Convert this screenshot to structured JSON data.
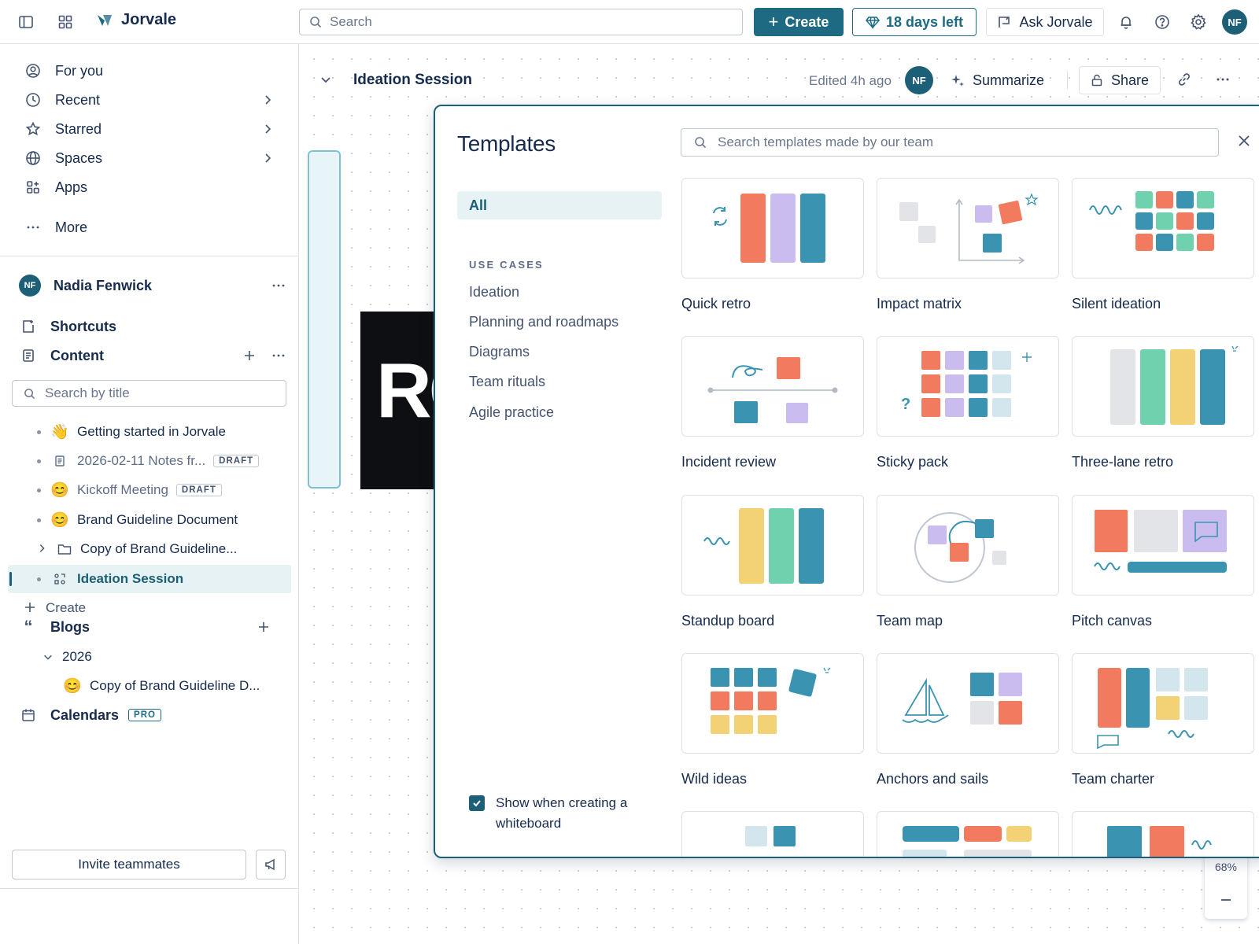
{
  "app": {
    "name": "Jorvale"
  },
  "topbar": {
    "search_placeholder": "Search",
    "create_label": "Create",
    "trial_label": "18 days left",
    "ask_label": "Ask Jorvale",
    "avatar_initials": "NF"
  },
  "sidebar": {
    "nav": [
      {
        "label": "For you",
        "icon": "user-circle-icon"
      },
      {
        "label": "Recent",
        "icon": "clock-icon"
      },
      {
        "label": "Starred",
        "icon": "star-icon"
      },
      {
        "label": "Spaces",
        "icon": "globe-icon"
      },
      {
        "label": "Apps",
        "icon": "apps-icon"
      },
      {
        "label": "More",
        "icon": "more-icon"
      }
    ],
    "space": {
      "name": "Nadia Fenwick",
      "avatar_initials": "NF"
    },
    "shortcuts_label": "Shortcuts",
    "content_label": "Content",
    "search_placeholder": "Search by title",
    "tree": [
      {
        "label": "Getting started in Jorvale",
        "emoji": "👋"
      },
      {
        "label": "2026-02-11 Notes fr...",
        "badge": "DRAFT"
      },
      {
        "label": "Kickoff Meeting",
        "emoji": "😊",
        "badge": "DRAFT"
      },
      {
        "label": "Brand Guideline Document",
        "emoji": "😊"
      },
      {
        "label": "Copy of Brand Guideline..."
      },
      {
        "label": "Ideation Session"
      }
    ],
    "create_label": "Create",
    "blogs_label": "Blogs",
    "blog_year": "2026",
    "blog_item": {
      "label": "Copy of Brand Guideline D...",
      "emoji": "😊"
    },
    "calendars_label": "Calendars",
    "calendars_badge": "PRO",
    "invite_label": "Invite teammates"
  },
  "document": {
    "title": "Ideation Session",
    "edited": "Edited 4h ago",
    "avatar_initials": "NF",
    "summarize_label": "Summarize",
    "share_label": "Share",
    "canvas_text": "RC",
    "zoom": "68%"
  },
  "templates": {
    "title": "Templates",
    "search_placeholder": "Search templates made by our team",
    "all_label": "All",
    "use_cases_heading": "USE CASES",
    "categories": [
      "Ideation",
      "Planning and roadmaps",
      "Diagrams",
      "Team rituals",
      "Agile practice"
    ],
    "show_when_creating": "Show when creating a whiteboard",
    "show_when_creating_checked": true,
    "items": [
      {
        "name": "Quick retro"
      },
      {
        "name": "Impact matrix"
      },
      {
        "name": "Silent ideation"
      },
      {
        "name": "Incident review"
      },
      {
        "name": "Sticky pack"
      },
      {
        "name": "Three-lane retro"
      },
      {
        "name": "Standup board"
      },
      {
        "name": "Team map"
      },
      {
        "name": "Pitch canvas"
      },
      {
        "name": "Wild ideas"
      },
      {
        "name": "Anchors and sails"
      },
      {
        "name": "Team charter"
      }
    ]
  },
  "colors": {
    "brand": "#1d6a82",
    "coral": "#f27a5e",
    "lavender": "#cbbcef",
    "teal": "#3a93b0",
    "mint": "#6fd1ad",
    "yellow": "#f3d275",
    "grey": "#e2e4e8"
  }
}
